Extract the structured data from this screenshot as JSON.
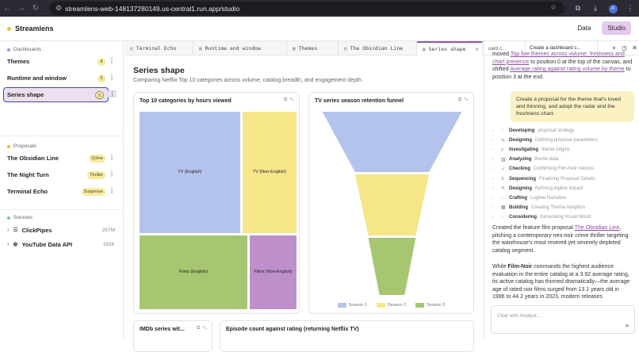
{
  "browser": {
    "url": "streamlens-web-148137280149.us-central1.run.app/studio",
    "avatar": "A"
  },
  "app": {
    "name": "Streamlens",
    "nav_data": "Data",
    "nav_studio": "Studio"
  },
  "sidebar": {
    "dashboards_label": "Dashboards",
    "dashboards": [
      {
        "label": "Themes",
        "count": "4"
      },
      {
        "label": "Runtime and window",
        "count": "5"
      },
      {
        "label": "Series shape",
        "count": "5"
      }
    ],
    "proposals_label": "Proposals",
    "proposals": [
      {
        "label": "The Obsidian Line",
        "badge": "Crime"
      },
      {
        "label": "The Night Turn",
        "badge": "Thriller"
      },
      {
        "label": "Terminal Echo",
        "badge": "Suspense"
      }
    ],
    "sources_label": "Sources",
    "sources": [
      {
        "label": "ClickPipes",
        "size": "267M"
      },
      {
        "label": "YouTube Data API",
        "size": "192K"
      }
    ]
  },
  "tabs": [
    {
      "label": "Terminal Echo"
    },
    {
      "label": "Runtime and window"
    },
    {
      "label": "Themes"
    },
    {
      "label": "The Obsidian Line"
    },
    {
      "label": "Series shape"
    }
  ],
  "main": {
    "title": "Series shape",
    "subtitle": "Comparing Netflix Top 10 categories across volume, catalog breadth, and engagement depth.",
    "card1_title": "Top 10 categories by hours viewed",
    "card2_title": "TV series season retention funnel",
    "card3_title": "IMDb series wit...",
    "card4_title": "Episode count against rating (returning Netflix TV)"
  },
  "chart_data": [
    {
      "type": "treemap",
      "title": "Top 10 categories by hours viewed",
      "categories": [
        "TV (English)",
        "TV (Non-English)",
        "Films (English)",
        "Films (Non-English)"
      ],
      "values": [
        40.3,
        21.7,
        26.5,
        11.5
      ],
      "colors": [
        "#b3c3ec",
        "#f6e68a",
        "#a7c671",
        "#bd8fcb"
      ]
    },
    {
      "type": "funnel",
      "title": "TV series season retention funnel",
      "categories": [
        "Season 1",
        "Season 2",
        "Season 3"
      ],
      "values": [
        100,
        53,
        34
      ],
      "colors": [
        "#b3c3ec",
        "#f6e68a",
        "#a7c671"
      ],
      "legend_position": "bottom"
    }
  ],
  "right_panel": {
    "tabs": [
      {
        "label": "oard c..."
      },
      {
        "label": "Create a dashboard c..."
      }
    ],
    "top_text_1": "moved ",
    "top_link_1": "Top five themes across volume, freshness and chart presence",
    "top_text_2": " to position 0 at the top of the canvas, and shifted ",
    "top_link_2": "Average rating against rating volume by theme",
    "top_text_3": " to position 3 at the end.",
    "bubble": "Create a proposal for the theme that's loved and thinning, and adopt the radar and the freshness chart.",
    "steps": [
      {
        "label": "Developing",
        "detail": "proposal strategy",
        "icon": "bulb-icon"
      },
      {
        "label": "Designing",
        "detail": "Defining proposal parameters",
        "icon": "pencil-icon"
      },
      {
        "label": "Investigating",
        "detail": "theme origins",
        "icon": "search-icon"
      },
      {
        "label": "Analyzing",
        "detail": "theme data",
        "icon": "chart-icon"
      },
      {
        "label": "Checking",
        "detail": "Confirming Film-Noir metrics",
        "icon": "check-icon"
      },
      {
        "label": "Sequencing",
        "detail": "Finalizing Proposal Details",
        "icon": "sequence-icon"
      },
      {
        "label": "Designing",
        "detail": "Refining logline impact",
        "icon": "pencil-icon"
      },
      {
        "label": "Crafting",
        "detail": "Logline Narrative",
        "icon": "bulb-icon"
      },
      {
        "label": "Building",
        "detail": "Creating Theme Adoption",
        "icon": "grid-icon"
      },
      {
        "label": "Considering",
        "detail": "Generating Visual Mood",
        "icon": "bulb-icon"
      }
    ],
    "para1_a": "Created the feature film proposal ",
    "para1_link": "The Obsidian Line",
    "para1_b": ", pitching a contemporary neo-noir crime thriller targeting the warehouse's most revered yet severely depleted catalog segment.",
    "para2_a": "While ",
    "para2_bold": "Film-Noir",
    "para2_b": " commands the highest audience evaluation in the entire catalog at a 3.92 average rating, its active catalog has thinned dramatically—the average age of rated noir films surged from 13.1 years old in 1996 to 44.2 years in 2023, modern releases",
    "chat_placeholder": "Chat with Analyst..."
  }
}
